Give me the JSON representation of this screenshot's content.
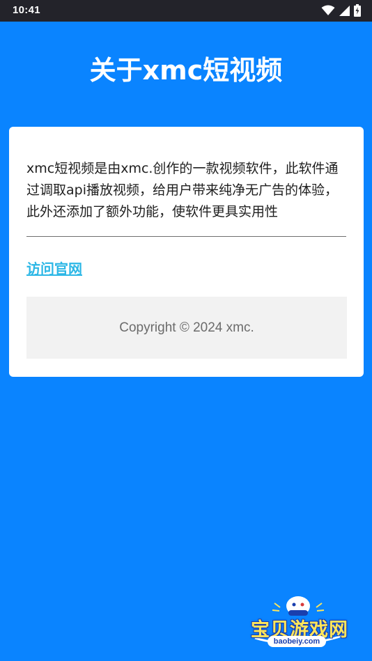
{
  "status_bar": {
    "time": "10:41",
    "icons": [
      "wifi-icon",
      "signal-icon",
      "battery-icon"
    ]
  },
  "header": {
    "title": "关于xmc短视频"
  },
  "card": {
    "description": "xmc短视频是由xmc.创作的一款视频软件，此软件通过调取api播放视频，给用户带来纯净无广告的体验，此外还添加了额外功能，使软件更具实用性",
    "link_label": "访问官网",
    "copyright": "Copyright © 2024 xmc."
  },
  "watermark": {
    "text": "宝贝游戏网",
    "url": "baobeiy.com"
  },
  "colors": {
    "background": "#0a84ff",
    "status_bar": "#23232a",
    "card": "#ffffff",
    "link": "#2cb7e6",
    "copyright_box": "#f2f2f2"
  }
}
